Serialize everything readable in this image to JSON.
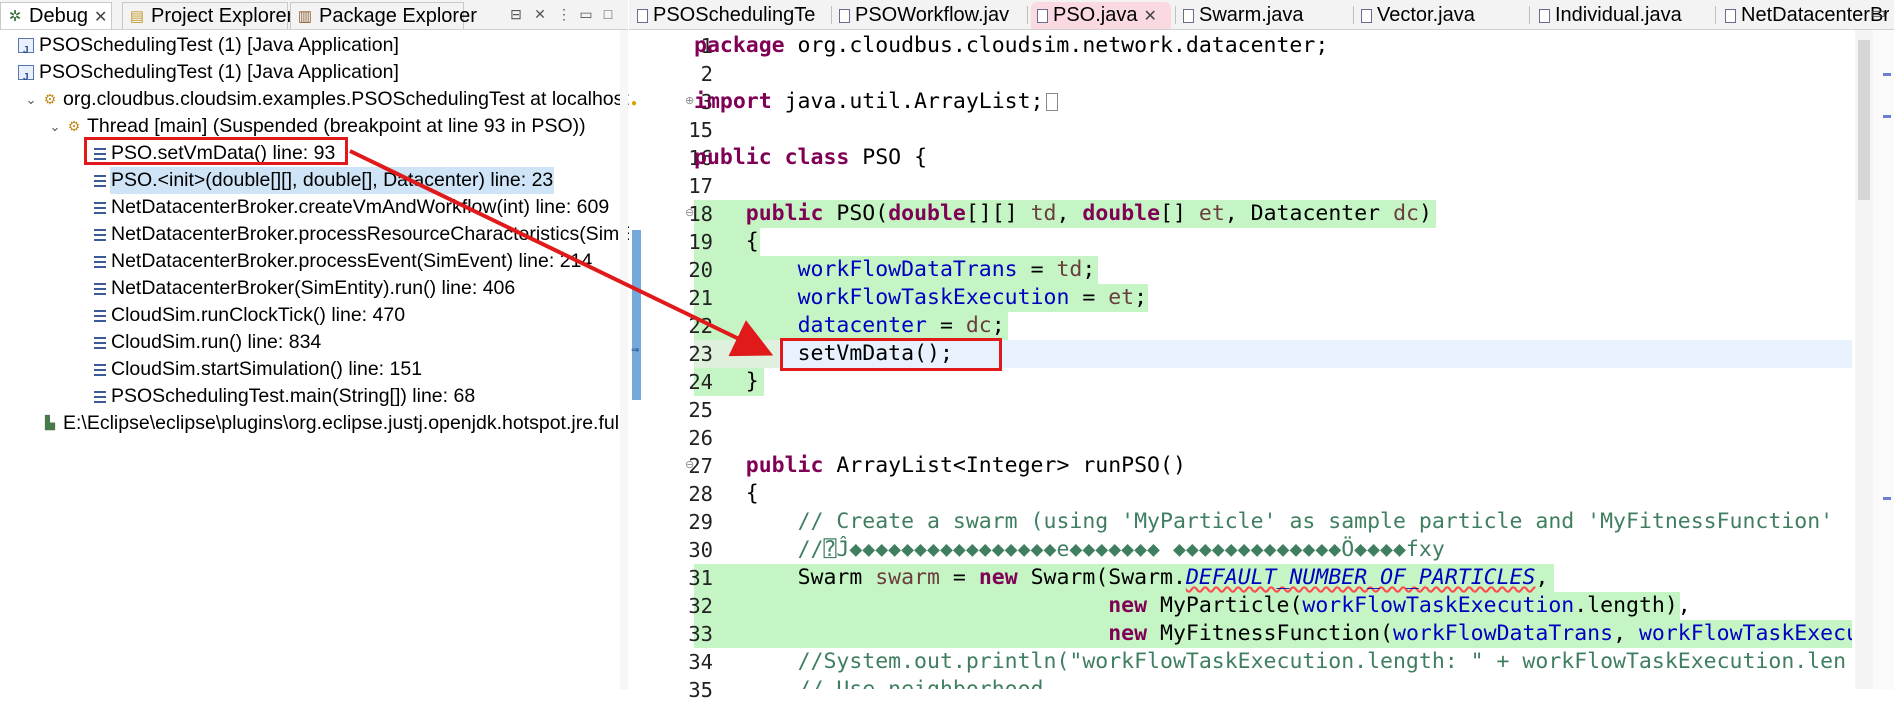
{
  "left_tabs": [
    {
      "label": "Debug",
      "icon": "bug-icon",
      "active": true,
      "closable": true
    },
    {
      "label": "Project Explorer",
      "icon": "folder-icon",
      "active": false,
      "closable": false
    },
    {
      "label": "Package Explorer",
      "icon": "package-icon",
      "active": false,
      "closable": false
    }
  ],
  "tree": {
    "launch1": "PSOSchedulingTest (1) [Java Application]",
    "launch2": "PSOSchedulingTest (1) [Java Application]",
    "process": "org.cloudbus.cloudsim.examples.PSOSchedulingTest at localhost:",
    "thread": "Thread [main] (Suspended (breakpoint at line 93 in PSO))",
    "frames": [
      "PSO.setVmData() line: 93",
      "PSO.<init>(double[][], double[], Datacenter) line: 23",
      "NetDatacenterBroker.createVmAndWorkflow(int) line: 609",
      "NetDatacenterBroker.processResourceCharacteristics(SimEv",
      "NetDatacenterBroker.processEvent(SimEvent) line: 214",
      "NetDatacenterBroker(SimEntity).run() line: 406",
      "CloudSim.runClockTick() line: 470",
      "CloudSim.run() line: 834",
      "CloudSim.startSimulation() line: 151",
      "PSOSchedulingTest.main(String[]) line: 68"
    ],
    "jre": "E:\\Eclipse\\eclipse\\plugins\\org.eclipse.justj.openjdk.hotspot.jre.full"
  },
  "editor_tabs": [
    {
      "label": "PSOSchedulingTe",
      "active": false
    },
    {
      "label": "PSOWorkflow.jav",
      "active": false
    },
    {
      "label": "PSO.java",
      "active": true
    },
    {
      "label": "Swarm.java",
      "active": false
    },
    {
      "label": "Vector.java",
      "active": false
    },
    {
      "label": "Individual.java",
      "active": false
    },
    {
      "label": "NetDatacenterBr",
      "active": false
    }
  ],
  "line_numbers": [
    "1",
    "2",
    "3",
    "15",
    "16",
    "17",
    "18",
    "19",
    "20",
    "21",
    "22",
    "23",
    "24",
    "25",
    "26",
    "27",
    "28",
    "29",
    "30",
    "31",
    "32",
    "33",
    "34",
    "35"
  ],
  "code": {
    "l1_kw": "package",
    "l1_rest": " org.cloudbus.cloudsim.network.datacenter;",
    "l3_kw": "import",
    "l3_rest": " java.util.ArrayList;",
    "l16_kw": "public class",
    "l16_rest": " PSO {",
    "l18_kw1": "public",
    "l18_a": " PSO(",
    "l18_kw2": "double",
    "l18_b": "[][] ",
    "l18_p1": "td",
    "l18_c": ", ",
    "l18_kw3": "double",
    "l18_d": "[] ",
    "l18_p2": "et",
    "l18_e": ", Datacenter ",
    "l18_p3": "dc",
    "l18_f": ")",
    "l19": "{",
    "l20_f": "workFlowDataTrans",
    "l20_m": " = ",
    "l20_p": "td",
    "l20_e": ";",
    "l21_f": "workFlowTaskExecution",
    "l21_m": " = ",
    "l21_p": "et",
    "l21_e": ";",
    "l22_f": "datacenter",
    "l22_m": " = ",
    "l22_p": "dc",
    "l22_e": ";",
    "l23": "setVmData();",
    "l24": "}",
    "l27_kw": "public",
    "l27_rest": " ArrayList<Integer> runPSO()",
    "l28": "{",
    "l29": "// Create a swarm (using 'MyParticle' as sample particle and 'MyFitnessFunction'",
    "l30": "//⍰Ĵ◆◆◆◆◆◆◆◆◆◆◆◆◆◆◆◆e◆◆◆◆◆◆◆ ◆◆◆◆◆◆◆◆◆◆◆◆◆Ö◆◆◆◆fxy",
    "l31_a": "Swarm ",
    "l31_v": "swarm",
    "l31_b": " = ",
    "l31_kw": "new",
    "l31_c": " Swarm(Swarm.",
    "l31_s": "DEFAULT_NUMBER_OF_PARTICLES",
    "l31_d": ",",
    "l32_kw": "new",
    "l32_a": " MyParticle(",
    "l32_f": "workFlowTaskExecution",
    "l32_b": ".length),",
    "l33_kw": "new",
    "l33_a": " MyFitnessFunction(",
    "l33_f1": "workFlowDataTrans",
    "l33_b": ", ",
    "l33_f2": "workFlowTaskExecu",
    "l34": "//System.out.println(\"workFlowTaskExecution.length: \" + workFlowTaskExecution.len",
    "l35": "// Use neighborhood"
  },
  "colors": {
    "keyword": "#7f0055",
    "field": "#0000c0",
    "comment": "#3f7f5f",
    "highlight": "#c5f5c5",
    "annotation": "#e01a1a"
  }
}
